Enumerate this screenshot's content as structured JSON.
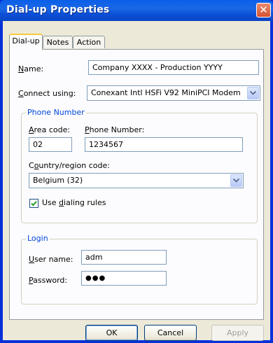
{
  "window": {
    "title": "Dial-up Properties",
    "close_symbol": "✕"
  },
  "tabs": [
    {
      "label": "Dial-up",
      "active": true
    },
    {
      "label": "Notes",
      "active": false
    },
    {
      "label": "Action",
      "active": false
    }
  ],
  "name": {
    "label_accel": "N",
    "label_rest": "ame:",
    "value": "Company XXXX - Production YYYY"
  },
  "connect_using": {
    "label_accel": "C",
    "label_rest": "onnect using:",
    "value": "Conexant Intl HSFi V92 MiniPCI Modem"
  },
  "phone_group": {
    "legend": "Phone Number",
    "area_code": {
      "label_accel": "A",
      "label_rest": "rea code:",
      "value": "02"
    },
    "phone_number": {
      "label_accel": "P",
      "label_rest": "hone Number:",
      "value": "1234567"
    },
    "country": {
      "label_pre": "C",
      "label_accel": "o",
      "label_rest": "untry/region code:",
      "value": "Belgium (32)"
    },
    "dialing_rules": {
      "label_pre": "Use ",
      "label_accel": "d",
      "label_rest": "ialing rules",
      "checked": true
    }
  },
  "login_group": {
    "legend": "Login",
    "user_name": {
      "label_accel": "U",
      "label_rest": "ser name:",
      "value": "adm"
    },
    "password": {
      "label_accel": "P",
      "label_rest": "assword:",
      "value": "●●●"
    }
  },
  "buttons": {
    "ok": "OK",
    "cancel": "Cancel",
    "apply": "Apply"
  },
  "colors": {
    "title_bar": "#0a5ee8",
    "group_legend": "#0046d5",
    "dialog_bg": "#ece9d8"
  }
}
